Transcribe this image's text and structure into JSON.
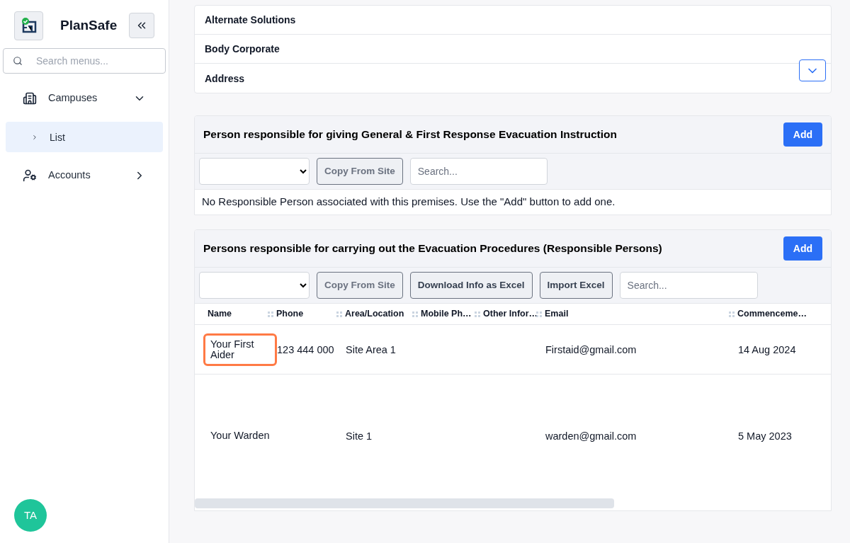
{
  "app": {
    "name": "PlanSafe"
  },
  "sidebar": {
    "search": {
      "placeholder": "Search menus..."
    },
    "items": [
      {
        "label": "Campuses",
        "expanded": true,
        "children": [
          {
            "label": "List",
            "selected": true
          }
        ]
      },
      {
        "label": "Accounts",
        "expanded": false
      }
    ],
    "avatar": {
      "initials": "TA"
    }
  },
  "details": {
    "rows": [
      "Alternate Solutions",
      "Body Corporate",
      "Address"
    ]
  },
  "instruction_panel": {
    "title": "Person responsible for giving General & First Response Evacuation Instruction",
    "add_button": "Add",
    "toolbar": [
      "Copy From Site"
    ],
    "search": {
      "placeholder": "Search..."
    },
    "empty_message": "No Responsible Person associated with this premises. Use the \"Add\" button to add one."
  },
  "procedures_panel": {
    "title": "Persons responsible for carrying out the Evacuation Procedures (Responsible Persons)",
    "add_button": "Add",
    "toolbar": [
      "Copy From Site",
      "Download Info as Excel",
      "Import Excel"
    ],
    "search": {
      "placeholder": "Search..."
    },
    "table": {
      "columns": [
        "Name",
        "Phone",
        "Area/Location",
        "Mobile Ph…",
        "Other Infor…",
        "Email",
        "Commenceme…"
      ],
      "rows": [
        {
          "highlighted": true,
          "cells": [
            "Your First Aider",
            "123 444 000",
            "Site Area 1",
            "",
            "",
            "Firstaid@gmail.com",
            "14 Aug 2024"
          ]
        },
        {
          "highlighted": false,
          "cells": [
            "Your Warden",
            "",
            "Site 1",
            "",
            "",
            "warden@gmail.com",
            "5 May 2023"
          ]
        }
      ]
    }
  }
}
